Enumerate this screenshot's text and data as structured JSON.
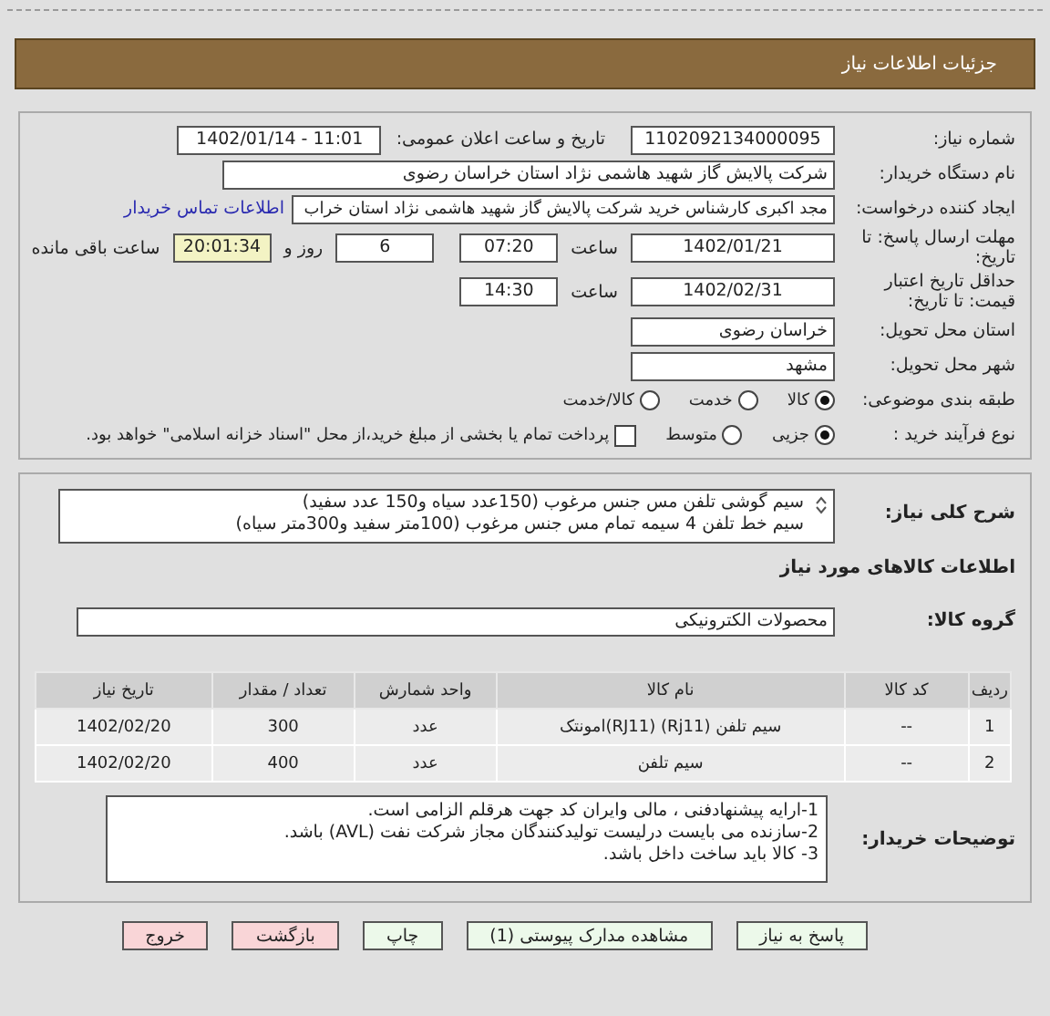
{
  "header": {
    "title": "جزئیات اطلاعات نیاز"
  },
  "need_number": {
    "label": "شماره نیاز:",
    "value": "1102092134000095"
  },
  "announce": {
    "label": "تاریخ و ساعت اعلان عمومی:",
    "value": "1402/01/14 - 11:01"
  },
  "buyer": {
    "label": "نام دستگاه خریدار:",
    "value": "شرکت پالایش گاز شهید هاشمی نژاد   استان خراسان رضوی"
  },
  "creator": {
    "label": "ایجاد کننده درخواست:",
    "value": "مجد اکبری کارشناس خرید شرکت پالایش گاز شهید هاشمی نژاد   استان خراب",
    "link": "اطلاعات تماس خریدار"
  },
  "deadline": {
    "label": "مهلت ارسال پاسخ: تا تاریخ:",
    "date": "1402/01/21",
    "time_label": "ساعت",
    "time": "07:20",
    "days": "6",
    "days_label": "روز و",
    "remaining": "20:01:34",
    "remaining_label": "ساعت باقی مانده"
  },
  "validity": {
    "label": "حداقل تاریخ اعتبار قیمت: تا تاریخ:",
    "date": "1402/02/31",
    "time_label": "ساعت",
    "time": "14:30"
  },
  "province": {
    "label": "استان محل تحویل:",
    "value": "خراسان رضوی"
  },
  "city": {
    "label": "شهر محل تحویل:",
    "value": "مشهد"
  },
  "category": {
    "label": "طبقه بندی موضوعی:",
    "options": [
      {
        "label": "کالا",
        "selected": true
      },
      {
        "label": "خدمت",
        "selected": false
      },
      {
        "label": "کالا/خدمت",
        "selected": false
      }
    ]
  },
  "purchase": {
    "label": "نوع فرآیند خرید :",
    "options": [
      {
        "label": "جزیی",
        "selected": true
      },
      {
        "label": "متوسط",
        "selected": false
      }
    ],
    "payment": {
      "label": "پرداخت تمام یا بخشی از مبلغ خرید،از محل \"اسناد خزانه اسلامی\" خواهد بود.",
      "checked": false
    }
  },
  "summary": {
    "label": "شرح کلی نیاز:",
    "lines": [
      "سیم گوشی تلفن مس جنس مرغوب (150عدد سیاه و150 عدد سفید)",
      "سیم خط تلفن 4 سیمه تمام مس جنس مرغوب (100متر سفید و300متر سیاه)"
    ]
  },
  "goods_heading": "اطلاعات کالاهای مورد نیاز",
  "goods_group": {
    "label": "گروه کالا:",
    "value": "محصولات الکترونیکی"
  },
  "table": {
    "columns": [
      "ردیف",
      "کد کالا",
      "نام کالا",
      "واحد شمارش",
      "تعداد / مقدار",
      "تاریخ نیاز"
    ],
    "rows": [
      [
        "1",
        "--",
        "سیم تلفن (Rj11) (RJ11)امونتک",
        "عدد",
        "300",
        "1402/02/20"
      ],
      [
        "2",
        "--",
        "سیم تلفن",
        "عدد",
        "400",
        "1402/02/20"
      ]
    ]
  },
  "notes": {
    "label": "توضیحات خریدار:",
    "lines": [
      "1-ارایه پیشنهادفنی ، مالی وایران کد جهت هرقلم الزامی است.",
      "2-سازنده می بایست درلیست تولیدکنندگان مجاز شرکت نفت (AVL)  باشد.",
      "3- کالا باید ساخت  داخل باشد."
    ]
  },
  "buttons": [
    {
      "label": "پاسخ به نیاز",
      "kind": "primary"
    },
    {
      "label": "مشاهده مدارک پیوستی (1)",
      "kind": "primary"
    },
    {
      "label": "چاپ",
      "kind": "primary"
    },
    {
      "label": "بازگشت",
      "kind": "danger"
    },
    {
      "label": "خروج",
      "kind": "danger"
    }
  ]
}
